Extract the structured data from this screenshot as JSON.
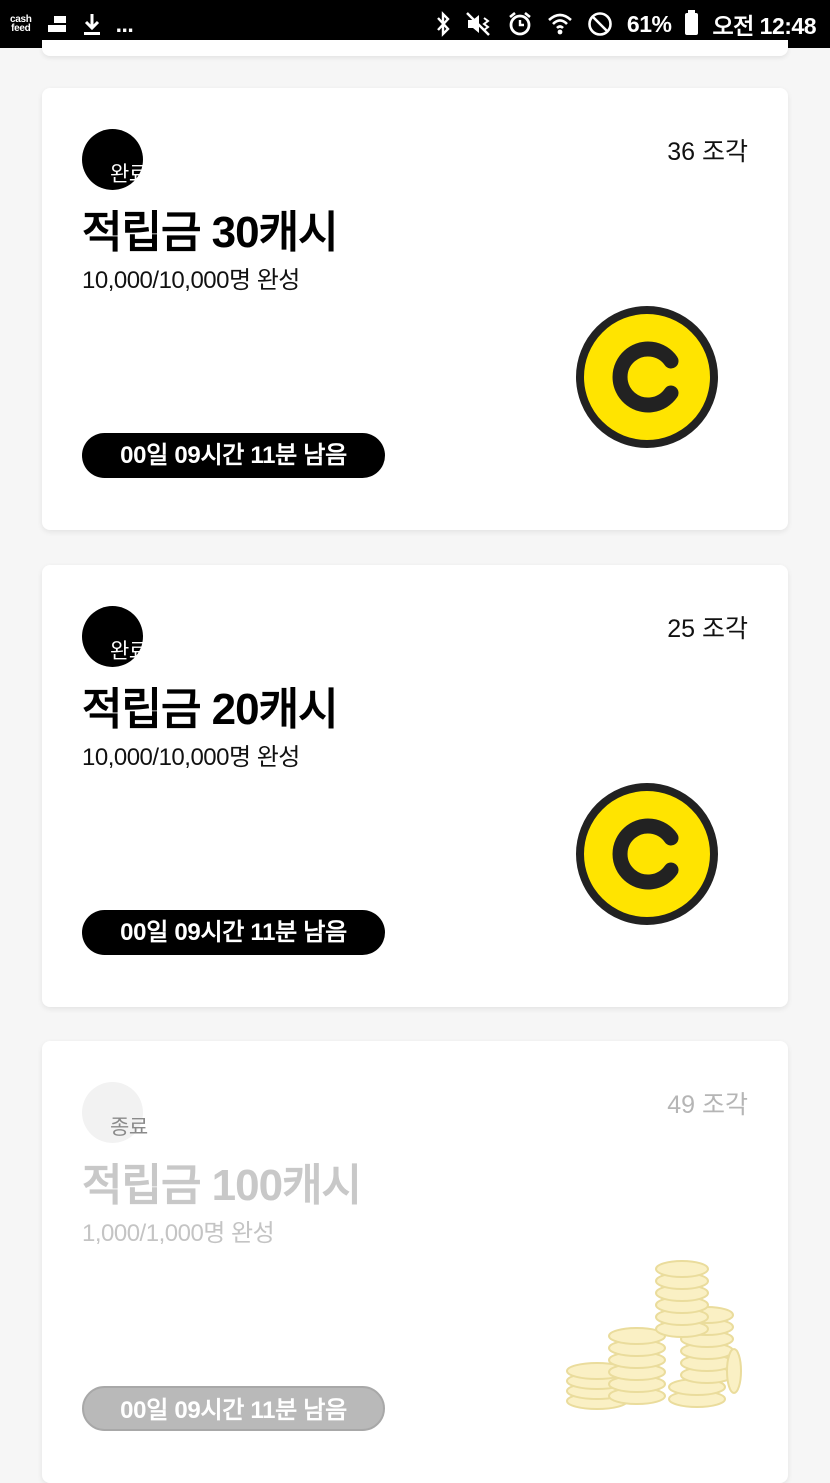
{
  "status_bar": {
    "app_label_top": "cash",
    "app_label_bottom": "feed",
    "more": "...",
    "battery": "61%",
    "time": "오전 12:48"
  },
  "cards": [
    {
      "badge": "완료",
      "pieces": "36 조각",
      "title": "적립금 30캐시",
      "progress": "10,000/10,000명 완성",
      "timer": "00일 09시간 11분 남음",
      "image": "coin-icon"
    },
    {
      "badge": "완료",
      "pieces": "25 조각",
      "title": "적립금 20캐시",
      "progress": "10,000/10,000명 완성",
      "timer": "00일 09시간 11분 남음",
      "image": "coin-icon"
    },
    {
      "badge": "종료",
      "pieces": "49 조각",
      "title": "적립금 100캐시",
      "progress": "1,000/1,000명 완성",
      "timer": "00일 09시간 11분 남음",
      "image": "coin-pile-image"
    }
  ],
  "colors": {
    "coin_fill": "#ffe400",
    "coin_outline": "#222222",
    "active_badge": "#000000",
    "ended_text": "#c8c8c8"
  }
}
